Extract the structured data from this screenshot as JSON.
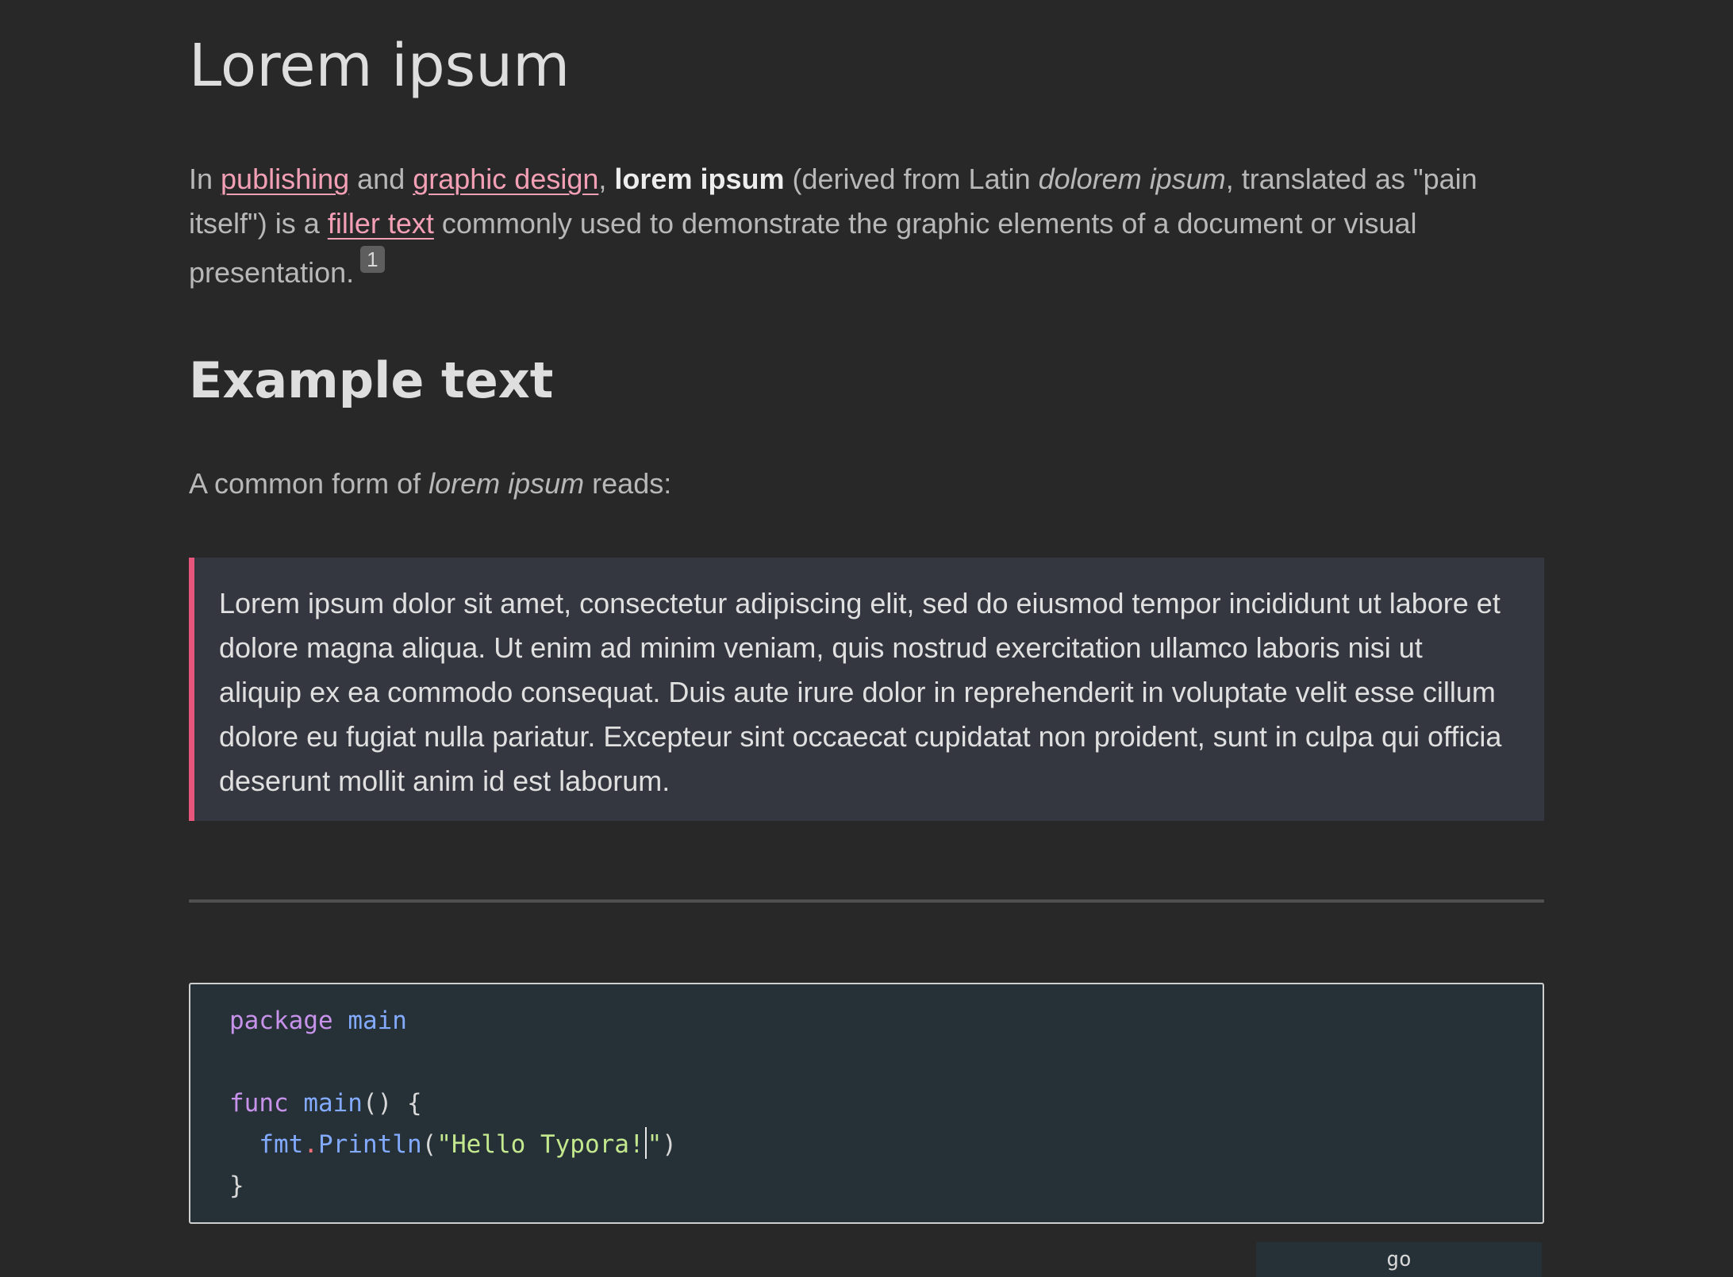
{
  "heading": "Lorem ipsum",
  "intro": {
    "t1": "In ",
    "link_publishing": "publishing",
    "t2": " and ",
    "link_graphic_design": "graphic design",
    "t3": ", ",
    "bold": "lorem ipsum",
    "t4": " (derived from Latin ",
    "italic": "dolorem ipsum",
    "t5": ", translated as \"pain itself\") is a ",
    "link_filler": "filler text",
    "t6": " commonly used to demonstrate the graphic elements of a document or visual presentation.",
    "footnote": "1"
  },
  "subheading": "Example text",
  "common": {
    "t1": "A common form of ",
    "italic": "lorem ipsum",
    "t2": " reads:"
  },
  "quote": "Lorem ipsum dolor sit amet, consectetur adipiscing elit, sed do eiusmod tempor incididunt ut labore et dolore magna aliqua. Ut enim ad minim veniam, quis nostrud exercitation ullamco laboris nisi ut aliquip ex ea commodo consequat. Duis aute irure dolor in reprehenderit in voluptate velit esse cillum dolore eu fugiat nulla pariatur. Excepteur sint occaecat cupidatat non proident, sunt in culpa qui officia deserunt mollit anim id est laborum.",
  "code": {
    "l1_kw": "package",
    "l1_name": " main",
    "l3_kw": "func",
    "l3_name": " main",
    "l3_rest": "() {",
    "l4_indent": "  ",
    "l4_pkg": "fmt",
    "l4_dot": ".",
    "l4_fn": "Println",
    "l4_open": "(",
    "l4_str_a": "\"Hello Typora!",
    "l4_str_b": "\"",
    "l4_close": ")",
    "l5": "}",
    "language": "go"
  },
  "colors": {
    "background": "#282828",
    "link": "#f3a0b6",
    "quote_border": "#e8557d",
    "quote_bg": "#353740",
    "code_bg": "#263037"
  }
}
